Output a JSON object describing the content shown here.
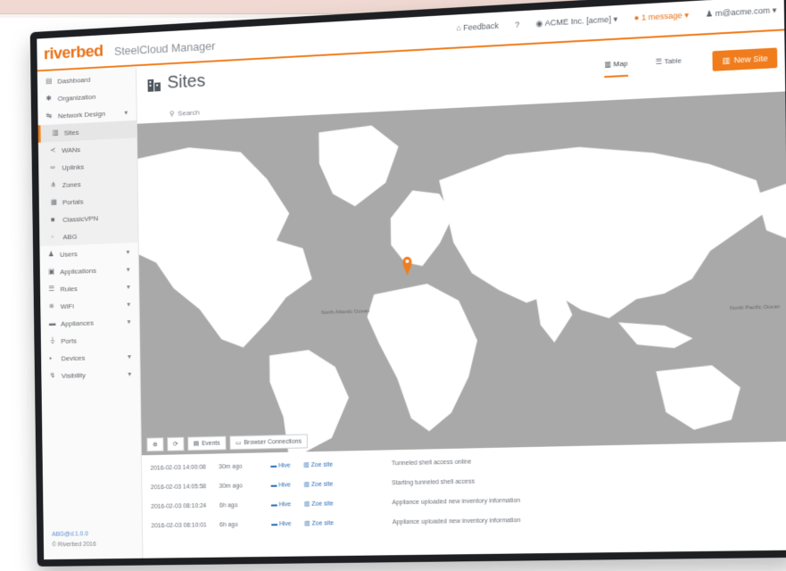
{
  "header": {
    "brand": "riverbed",
    "product": "SteelCloud Manager",
    "nav": [
      "Feedback",
      "?",
      "ACME Inc. [acme] ▾",
      "1 message ▾",
      "m@acme.com ▾"
    ]
  },
  "sidebar": {
    "items": [
      {
        "label": "Dashboard",
        "icon": "dashboard-icon"
      },
      {
        "label": "Organization",
        "icon": "gear-icon"
      },
      {
        "label": "Network Design",
        "icon": "network-icon"
      },
      {
        "label": "Sites",
        "icon": "building-icon"
      },
      {
        "label": "WANs",
        "icon": "share-icon"
      },
      {
        "label": "Uplinks",
        "icon": "link-icon"
      },
      {
        "label": "Zones",
        "icon": "sitemap-icon"
      },
      {
        "label": "Portals",
        "icon": "portal-icon"
      },
      {
        "label": "ClassicVPN",
        "icon": "lock-icon"
      },
      {
        "label": "ABG",
        "icon": "abg-icon"
      },
      {
        "label": "Users",
        "icon": "user-icon"
      },
      {
        "label": "Applications",
        "icon": "apps-icon"
      },
      {
        "label": "Rules",
        "icon": "rules-icon"
      },
      {
        "label": "WiFi",
        "icon": "wifi-icon"
      },
      {
        "label": "Appliances",
        "icon": "appliance-icon"
      },
      {
        "label": "Ports",
        "icon": "plug-icon"
      },
      {
        "label": "Devices",
        "icon": "device-icon"
      },
      {
        "label": "Visibility",
        "icon": "chart-icon"
      }
    ],
    "footer_version": "ABG@d.1.0.0",
    "footer_copyright": "© Riverbed 2016"
  },
  "content": {
    "title": "Sites",
    "search_label": "Search",
    "tabs": [
      "Map",
      "Table"
    ],
    "active_tab": "Map",
    "new_site_label": "New Site"
  },
  "map": {
    "ocean_labels": [
      "North Atlantic Ocean",
      "North Pacific Ocean"
    ],
    "controls": [
      "Events",
      "Browser Connections"
    ],
    "marker_color": "#f07c1c"
  },
  "events": [
    {
      "time": "2016-02-03 14:00:08",
      "ago": "30m ago",
      "link1": "Hive",
      "link2": "Zoe site",
      "message": "Tunneled shell access online"
    },
    {
      "time": "2016-02-03 14:05:58",
      "ago": "30m ago",
      "link1": "Hive",
      "link2": "Zoe site",
      "message": "Starting tunneled shell access"
    },
    {
      "time": "2016-02-03 08:10:24",
      "ago": "6h ago",
      "link1": "Hive",
      "link2": "Zoe site",
      "message": "Appliance uploaded new inventory information"
    },
    {
      "time": "2016-02-03 08:10:01",
      "ago": "6h ago",
      "link1": "Hive",
      "link2": "Zoe site",
      "message": "Appliance uploaded new inventory information"
    }
  ],
  "colors": {
    "accent": "#f07c1c",
    "map_water": "#a9a9a9",
    "map_land": "#ffffff"
  }
}
